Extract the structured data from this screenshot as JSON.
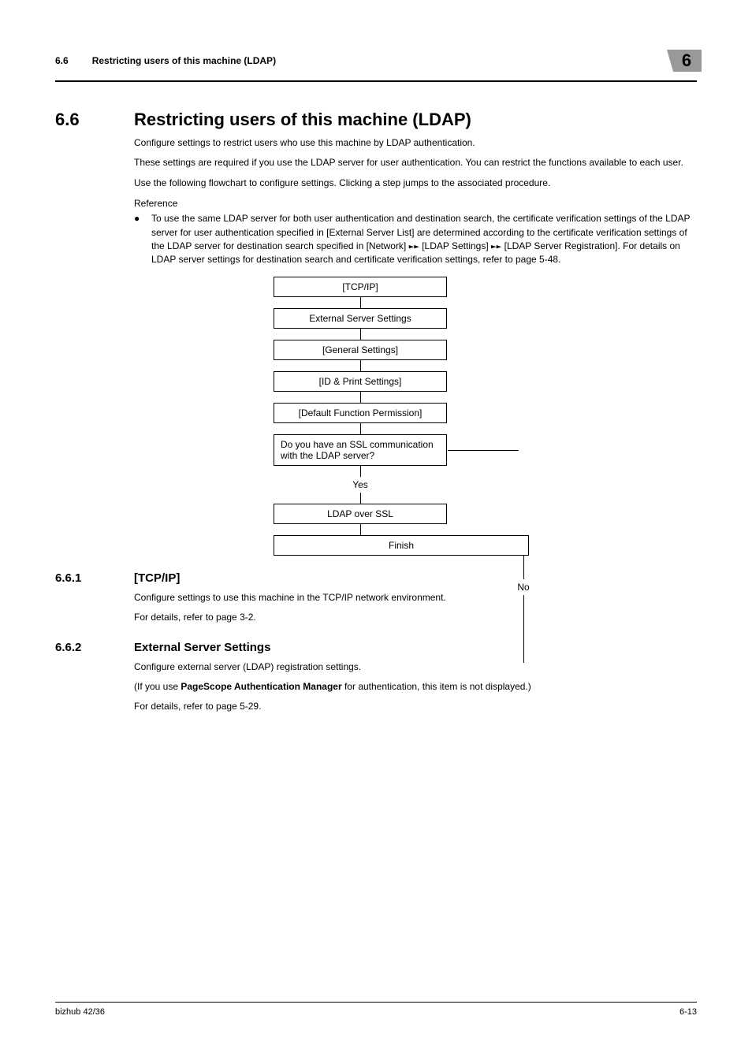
{
  "header": {
    "section_num": "6.6",
    "section_title": "Restricting users of this machine (LDAP)",
    "chapter": "6"
  },
  "main": {
    "h1_num": "6.6",
    "h1_title": "Restricting users of this machine (LDAP)",
    "p1": "Configure settings to restrict users who use this machine by LDAP authentication.",
    "p2": "These settings are required if you use the LDAP server for user authentication. You can restrict the functions available to each user.",
    "p3": "Use the following flowchart to configure settings. Clicking a step jumps to the associated procedure.",
    "reference": "Reference",
    "bullet1_part1": "To use the same LDAP server for both user authentication and destination search, the certificate verification settings of the LDAP server for user authentication specified in [External Server List] are determined according to the certificate verification settings of the LDAP server for destination search specified in [Network] ",
    "bullet1_part2": " [LDAP Settings] ",
    "bullet1_part3": " [LDAP Server Registration]. For details on LDAP server settings for destination search and certificate verification settings, refer to page 5-48."
  },
  "flowchart": {
    "box1": "[TCP/IP]",
    "box2": "External Server Settings",
    "box3": "[General Settings]",
    "box4": "[ID & Print Settings]",
    "box5": "[Default Function Permission]",
    "box6": "Do you have an SSL communication with the LDAP server?",
    "yes": "Yes",
    "no": "No",
    "box7": "LDAP over SSL",
    "finish": "Finish"
  },
  "sec661": {
    "num": "6.6.1",
    "title": "[TCP/IP]",
    "p1": "Configure settings to use this machine in the TCP/IP network environment.",
    "p2": "For details, refer to page 3-2."
  },
  "sec662": {
    "num": "6.6.2",
    "title": "External Server Settings",
    "p1": "Configure external server (LDAP) registration settings.",
    "p2_pre": "(If you use ",
    "p2_bold": "PageScope Authentication Manager",
    "p2_post": " for authentication, this item is not displayed.)",
    "p3": "For details, refer to page 5-29."
  },
  "footer": {
    "left": "bizhub 42/36",
    "right": "6-13"
  }
}
